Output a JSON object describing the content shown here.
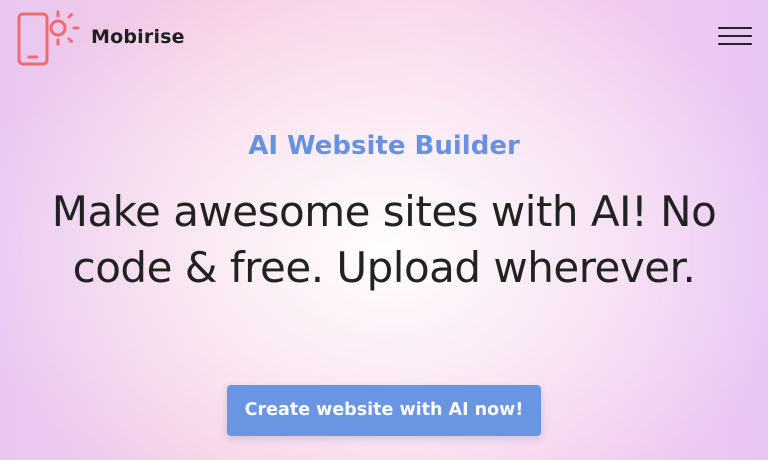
{
  "header": {
    "brand": "Mobirise",
    "logo_icon": "phone-sun-icon",
    "menu_icon": "hamburger-menu-icon"
  },
  "hero": {
    "eyebrow": "AI Website Builder",
    "headline": "Make awesome sites with AI! No code & free. Upload wherever.",
    "cta_label": "Create website with AI now!"
  },
  "colors": {
    "logo": "#f06b6b",
    "eyebrow": "#6692e0",
    "cta_background": "#6a95e3",
    "text": "#222222"
  }
}
